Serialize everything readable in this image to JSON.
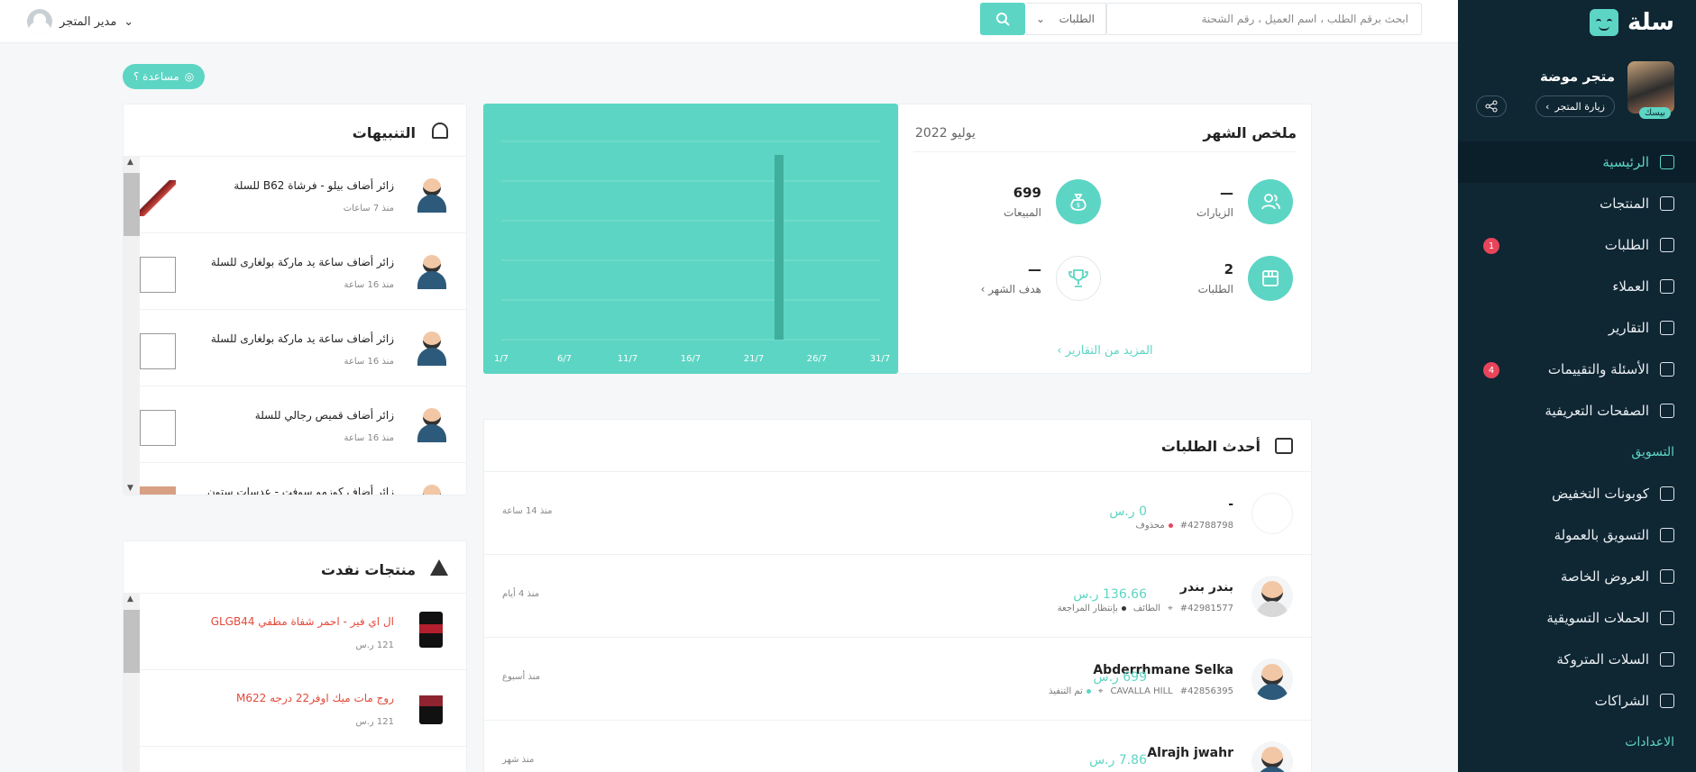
{
  "sidebar": {
    "brand": "سلة",
    "store_name": "متجر موضة",
    "store_plan": "بيسك",
    "visit_store": "زيارة المتجر",
    "items": [
      {
        "label": "الرئيسية",
        "icon": "home-icon"
      },
      {
        "label": "المنتجات",
        "icon": "shirt-icon"
      },
      {
        "label": "الطلبات",
        "icon": "box-icon",
        "badge": "1"
      },
      {
        "label": "العملاء",
        "icon": "users-icon"
      },
      {
        "label": "التقارير",
        "icon": "pie-chart-icon"
      },
      {
        "label": "الأسئلة والتقييمات",
        "icon": "message-icon",
        "badge": "4"
      },
      {
        "label": "الصفحات التعريفية",
        "icon": "pages-icon"
      }
    ],
    "marketing_section": "التسويق",
    "marketing_items": [
      {
        "label": "كوبونات التخفيض",
        "icon": "coupon-icon"
      },
      {
        "label": "التسويق بالعمولة",
        "icon": "dollar-icon"
      },
      {
        "label": "العروض الخاصة",
        "icon": "offer-icon"
      },
      {
        "label": "الحملات التسويقية",
        "icon": "send-icon"
      },
      {
        "label": "السلات المتروكة",
        "icon": "cart-icon"
      },
      {
        "label": "الشراكات",
        "icon": "partners-icon"
      }
    ],
    "settings_section": "الاعدادات"
  },
  "topbar": {
    "search_placeholder": "ابحث برقم الطلب ، اسم العميل ، رقم الشحنة",
    "search_type": "الطلبات",
    "user_name": "مدير المتجر"
  },
  "help_label": "مساعدة ؟",
  "summary": {
    "title": "ملخص الشهر",
    "month": "يوليو 2022",
    "visits_value": "—",
    "visits_label": "الزيارات",
    "sales_value": "699",
    "sales_label": "المبيعات",
    "orders_value": "2",
    "orders_label": "الطلبات",
    "goal_value": "—",
    "goal_label": "هدف الشهر",
    "more_reports": "المزيد من التقارير"
  },
  "chart_data": {
    "type": "bar",
    "categories": [
      "1/7",
      "6/7",
      "11/7",
      "16/7",
      "21/7",
      "26/7",
      "31/7"
    ],
    "x_days": [
      1,
      31
    ],
    "values": [
      {
        "day": 23,
        "value": 699
      }
    ],
    "ylim": [
      0,
      750
    ]
  },
  "orders": {
    "title": "أحدث الطلبات",
    "rows": [
      {
        "name": "-",
        "id": "#42788798",
        "status": "محذوف",
        "status_color": "#e8445a",
        "city": "",
        "amount": "0 ر.س",
        "time": "منذ 14 ساعة"
      },
      {
        "name": "بندر بندر",
        "id": "#42981577",
        "status": "بإنتظار المراجعة",
        "status_color": "#333333",
        "city": "الطائف",
        "amount": "136.66 ر.س",
        "time": "منذ 4 أيام"
      },
      {
        "name": "Abderrhmane Selka",
        "id": "#42856395",
        "status": "تم التنفيذ",
        "status_color": "#5dd5c4",
        "city": "CAVALLA HILL",
        "amount": "699 ر.س",
        "time": "منذ أسبوع"
      },
      {
        "name": "Alrajh jwahr",
        "id": "",
        "status": "",
        "status_color": "#5dd5c4",
        "city": "",
        "amount": "7.86 ر.س",
        "time": "منذ شهر"
      }
    ]
  },
  "notifications": {
    "title": "التنبيهات",
    "items": [
      {
        "text": "زائر أضاف بيلو - فرشاة B62 للسلة",
        "time": "منذ 7 ساعات"
      },
      {
        "text": "زائر أضاف ساعة يد ماركة بولغارى للسلة",
        "time": "منذ 16 ساعة"
      },
      {
        "text": "زائر أضاف ساعة يد ماركة بولغارى للسلة",
        "time": "منذ 16 ساعة"
      },
      {
        "text": "زائر أضاف قميص رجالي للسلة",
        "time": "منذ 16 ساعة"
      },
      {
        "text": "زائر أضاف كوزمو سوفت - عدسات ستون",
        "time": ""
      }
    ]
  },
  "out_of_stock": {
    "title": "منتجات نفدت",
    "items": [
      {
        "name": "ال اي فير - احمر شفاة مطفي GLGB44",
        "price": "121 ر.س"
      },
      {
        "name": "روج مات ميك اوفر22 درجه M622",
        "price": "121 ر.س"
      }
    ]
  }
}
